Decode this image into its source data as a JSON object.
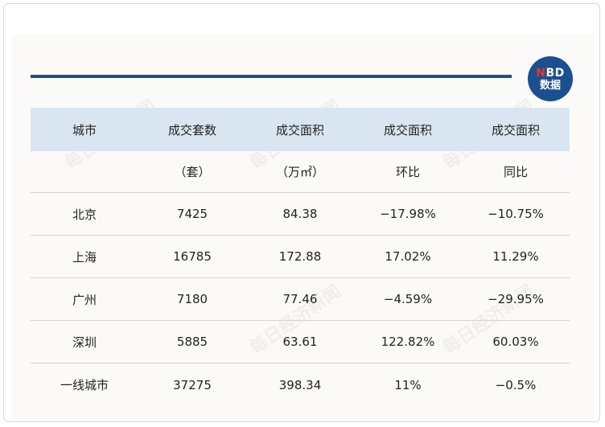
{
  "logo": {
    "brand_n": "N",
    "brand_rest": "BD",
    "sub": "数据"
  },
  "table": {
    "header_top": [
      "城市",
      "成交套数",
      "成交面积",
      "成交面积",
      "成交面积"
    ],
    "header_bottom": [
      "",
      "（套）",
      "（万㎡）",
      "环比",
      "同比"
    ],
    "rows": [
      [
        "北京",
        "7425",
        "84.38",
        "−17.98%",
        "−10.75%"
      ],
      [
        "上海",
        "16785",
        "172.88",
        "17.02%",
        "11.29%"
      ],
      [
        "广州",
        "7180",
        "77.46",
        "−4.59%",
        "−29.95%"
      ],
      [
        "深圳",
        "5885",
        "63.61",
        "122.82%",
        "60.03%"
      ],
      [
        "一线城市",
        "37275",
        "398.34",
        "11%",
        "−0.5%"
      ]
    ]
  },
  "watermark": "每日经济新闻"
}
